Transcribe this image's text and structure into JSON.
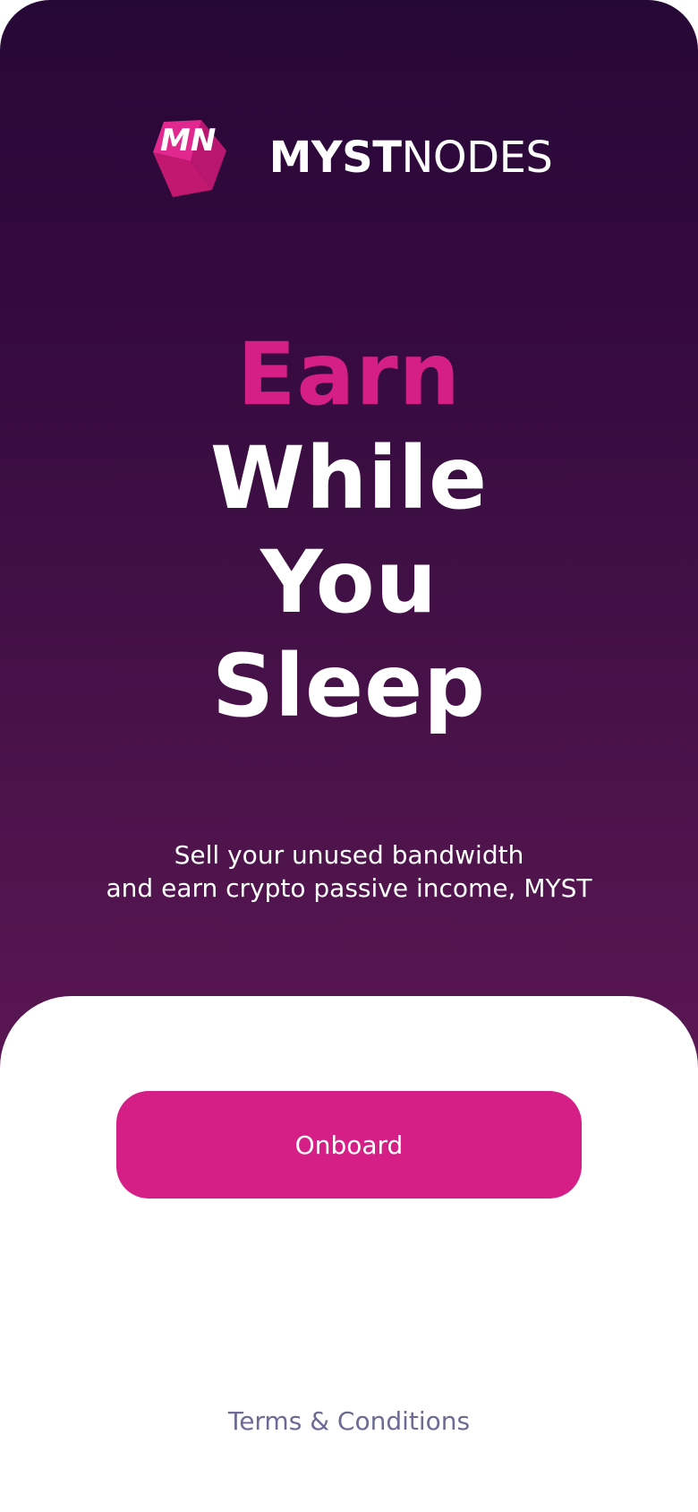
{
  "brand": {
    "name_bold": "MYST",
    "name_thin": "NODES",
    "logo_letters": "MN",
    "logo_icon": "mystnodes-cube-icon"
  },
  "headline": {
    "line1": "Earn",
    "line2": "While",
    "line3": "You",
    "line4": "Sleep"
  },
  "subtitle": {
    "line1": "Sell your unused bandwidth",
    "line2": "and earn crypto passive income, MYST"
  },
  "actions": {
    "onboard_label": "Onboard",
    "terms_label": "Terms & Conditions"
  },
  "colors": {
    "accent": "#d61f86",
    "hero_top": "#260836",
    "hero_bottom": "#5a1653",
    "terms_text": "#6b6b95"
  }
}
